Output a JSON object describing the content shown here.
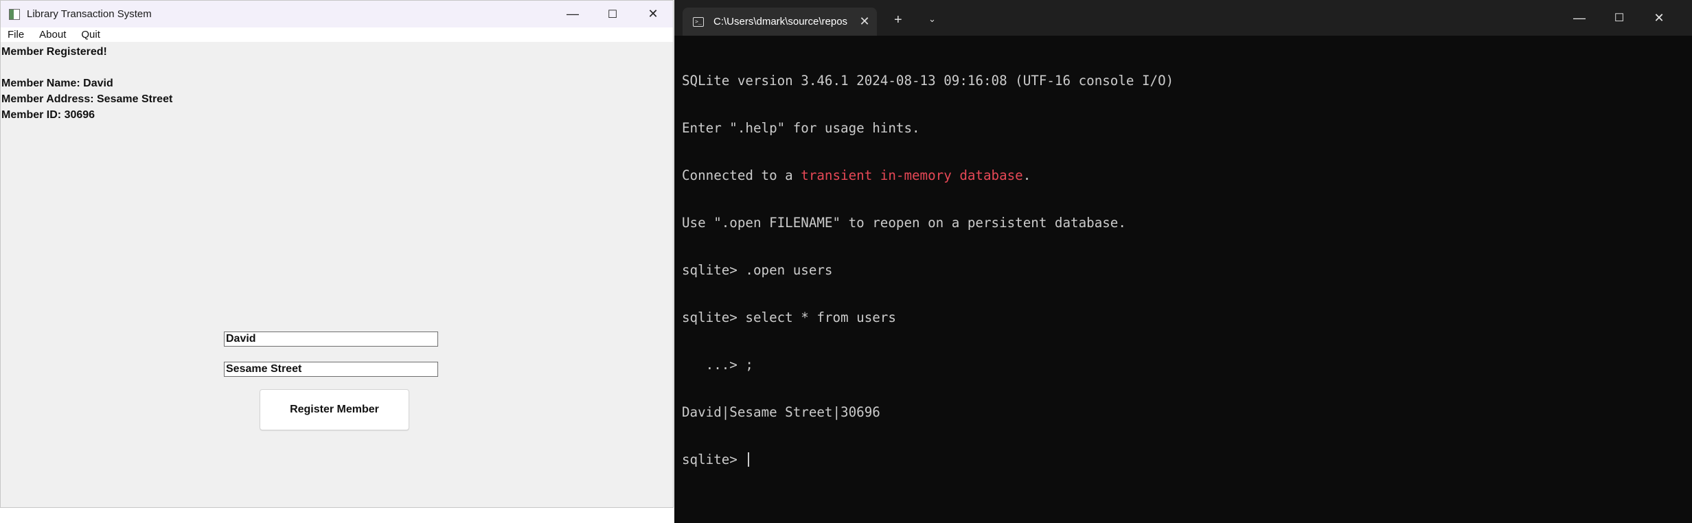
{
  "app": {
    "title": "Library Transaction System",
    "window_controls": {
      "minimize": "—",
      "maximize": "☐",
      "close": "✕"
    },
    "menu": {
      "file": "File",
      "about": "About",
      "quit": "Quit"
    },
    "output": {
      "status": "Member Registered!",
      "name_line": "Member Name: David",
      "address_line": "Member Address: Sesame Street",
      "id_line": "Member ID: 30696"
    },
    "form": {
      "name_value": "David",
      "address_value": "Sesame Street",
      "register_label": "Register Member"
    },
    "icons": {
      "app_icon": "window-app-icon"
    }
  },
  "terminal": {
    "tab_title": "C:\\Users\\dmark\\source\\repos",
    "tab_close": "✕",
    "new_tab": "+",
    "tab_menu": "⌄",
    "window_controls": {
      "minimize": "—",
      "maximize": "☐",
      "close": "✕"
    },
    "lines": {
      "l1": "SQLite version 3.46.1 2024-08-13 09:16:08 (UTF-16 console I/O)",
      "l2": "Enter \".help\" for usage hints.",
      "l3_pre": "Connected to a ",
      "l3_hl": "transient in-memory database",
      "l3_post": ".",
      "l4": "Use \".open FILENAME\" to reopen on a persistent database.",
      "l5": "sqlite> .open users",
      "l6": "sqlite> select * from users",
      "l7": "   ...> ;",
      "l8": "David|Sesame Street|30696",
      "l9": "sqlite> "
    },
    "colors": {
      "background": "#0c0c0c",
      "text": "#cccccc",
      "highlight": "#e74856"
    }
  }
}
